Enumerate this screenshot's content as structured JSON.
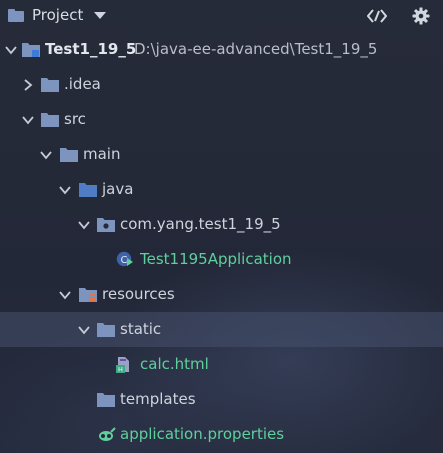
{
  "header": {
    "title": "Project",
    "icons": [
      "folder-icon",
      "dropdown-caret-icon",
      "code-toggle-icon",
      "settings-gear-icon"
    ]
  },
  "tree": {
    "root": {
      "name": "Test1_19_5",
      "path": "D:\\java-ee-advanced\\Test1_19_5"
    },
    "idea": "idea",
    "idea_label": ".idea",
    "src": "src",
    "main": "main",
    "java": "java",
    "package": "com.yang.test1_19_5",
    "application_class": "Test1195Application",
    "resources": "resources",
    "static": "static",
    "calc": "calc.html",
    "templates": "templates",
    "properties": "application.properties"
  },
  "colors": {
    "folder": "#7d94be",
    "text": "#cfd3dc",
    "green_text": "#5fcf9c",
    "selected_row": "#3c4560"
  }
}
